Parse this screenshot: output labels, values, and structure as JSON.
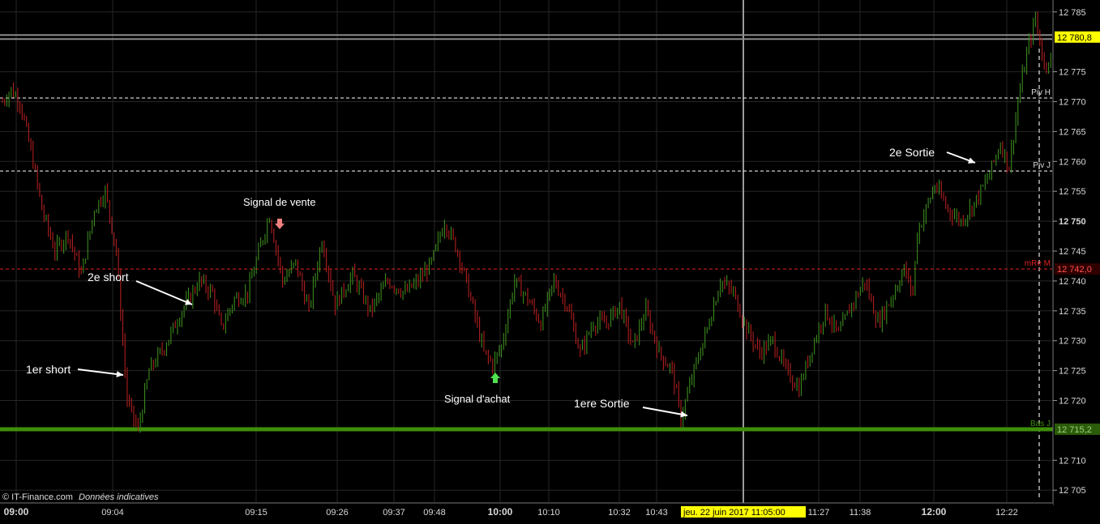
{
  "chart_data": {
    "type": "candlestick",
    "title": "",
    "ylim": [
      12703,
      12787
    ],
    "y_ticks": [
      {
        "value": 12785,
        "label": "12 785"
      },
      {
        "value": 12775,
        "label": "12 775"
      },
      {
        "value": 12770,
        "label": "12 770"
      },
      {
        "value": 12765,
        "label": "12 765"
      },
      {
        "value": 12760,
        "label": "12 760"
      },
      {
        "value": 12755,
        "label": "12 755"
      },
      {
        "value": 12750,
        "label": "12 750",
        "bold": true
      },
      {
        "value": 12745,
        "label": "12 745"
      },
      {
        "value": 12740,
        "label": "12 740"
      },
      {
        "value": 12735,
        "label": "12 735"
      },
      {
        "value": 12730,
        "label": "12 730"
      },
      {
        "value": 12725,
        "label": "12 725"
      },
      {
        "value": 12720,
        "label": "12 720"
      },
      {
        "value": 12710,
        "label": "12 710"
      },
      {
        "value": 12705,
        "label": "12 705"
      }
    ],
    "x_ticks": [
      {
        "time": "09:00",
        "bold": true
      },
      {
        "time": "09:04"
      },
      {
        "time": "09:15"
      },
      {
        "time": "09:26"
      },
      {
        "time": "09:37"
      },
      {
        "time": "09:48"
      },
      {
        "time": "10:00",
        "bold": true
      },
      {
        "time": "10:10"
      },
      {
        "time": "10:32"
      },
      {
        "time": "10:43"
      },
      {
        "time": "11:27"
      },
      {
        "time": "11:38"
      },
      {
        "time": "12:00",
        "bold": true
      },
      {
        "time": "12:22"
      }
    ],
    "crosshair": {
      "label": "jeu. 22 juin 2017 11:05:00"
    },
    "levels": [
      {
        "name": "",
        "value": 12780.8,
        "badge": "12 780,8",
        "style": "current",
        "color": "#8a8a8a",
        "badge_bg": "#ffff00"
      },
      {
        "name": "Piv H",
        "value": 12770.6,
        "style": "dashed",
        "color": "#ffffff"
      },
      {
        "name": "Piv J",
        "value": 12758.4,
        "style": "dashed",
        "color": "#ffffff"
      },
      {
        "name": "mRe M",
        "value": 12742.0,
        "badge": "12 742,0",
        "style": "dashed",
        "color": "#e02020"
      },
      {
        "name": "Bas J",
        "value": 12715.2,
        "badge": "12 715,2",
        "style": "solid",
        "color": "#3e8e0a"
      }
    ],
    "waypoints": [
      [
        0,
        12770
      ],
      [
        4,
        12772
      ],
      [
        8,
        12770
      ],
      [
        14,
        12760
      ],
      [
        18,
        12752
      ],
      [
        24,
        12745
      ],
      [
        30,
        12748
      ],
      [
        36,
        12741
      ],
      [
        42,
        12752
      ],
      [
        47,
        12755
      ],
      [
        52,
        12745
      ],
      [
        57,
        12720
      ],
      [
        62,
        12715
      ],
      [
        67,
        12725
      ],
      [
        74,
        12729
      ],
      [
        82,
        12735
      ],
      [
        90,
        12740
      ],
      [
        96,
        12738
      ],
      [
        100,
        12732
      ],
      [
        106,
        12737
      ],
      [
        112,
        12738
      ],
      [
        118,
        12746
      ],
      [
        122,
        12751
      ],
      [
        128,
        12740
      ],
      [
        134,
        12743
      ],
      [
        140,
        12735
      ],
      [
        146,
        12747
      ],
      [
        152,
        12736
      ],
      [
        160,
        12741
      ],
      [
        168,
        12735
      ],
      [
        176,
        12740
      ],
      [
        184,
        12738
      ],
      [
        190,
        12740
      ],
      [
        196,
        12743
      ],
      [
        202,
        12750
      ],
      [
        208,
        12745
      ],
      [
        214,
        12737
      ],
      [
        220,
        12728
      ],
      [
        224,
        12726
      ],
      [
        228,
        12729
      ],
      [
        234,
        12740
      ],
      [
        240,
        12737
      ],
      [
        246,
        12733
      ],
      [
        252,
        12740
      ],
      [
        258,
        12736
      ],
      [
        264,
        12728
      ],
      [
        270,
        12733
      ],
      [
        276,
        12733
      ],
      [
        282,
        12736
      ],
      [
        288,
        12729
      ],
      [
        294,
        12735
      ],
      [
        300,
        12728
      ],
      [
        306,
        12725
      ],
      [
        310,
        12717
      ],
      [
        316,
        12725
      ],
      [
        322,
        12732
      ],
      [
        328,
        12740
      ],
      [
        334,
        12738
      ],
      [
        340,
        12732
      ],
      [
        346,
        12728
      ],
      [
        352,
        12730
      ],
      [
        358,
        12725
      ],
      [
        364,
        12722
      ],
      [
        370,
        12729
      ],
      [
        376,
        12735
      ],
      [
        382,
        12731
      ],
      [
        388,
        12736
      ],
      [
        394,
        12740
      ],
      [
        400,
        12733
      ],
      [
        406,
        12737
      ],
      [
        412,
        12742
      ],
      [
        416,
        12738
      ],
      [
        418,
        12748
      ],
      [
        426,
        12756
      ],
      [
        432,
        12752
      ],
      [
        438,
        12750
      ],
      [
        444,
        12753
      ],
      [
        450,
        12757
      ],
      [
        456,
        12763
      ],
      [
        460,
        12759
      ],
      [
        464,
        12770
      ],
      [
        468,
        12778
      ],
      [
        472,
        12784
      ],
      [
        476,
        12776
      ],
      [
        480,
        12778
      ],
      [
        484,
        12780
      ]
    ],
    "annotations": [
      {
        "text": "Signal de vente"
      },
      {
        "text": "2e short"
      },
      {
        "text": "1er short"
      },
      {
        "text": "Signal d'achat"
      },
      {
        "text": "1ere Sortie"
      },
      {
        "text": "2e Sortie"
      }
    ],
    "signals": [
      {
        "type": "sell",
        "color": "#f08080"
      },
      {
        "type": "buy",
        "color": "#50e050"
      }
    ]
  },
  "footer": {
    "watermark": "© IT-Finance.com",
    "watermark_note": "Données indicatives"
  },
  "colors": {
    "background": "#000000",
    "up_candle": "#3c8a1e",
    "down_candle": "#b01e1e",
    "grid": "#262626",
    "axis_text": "#d8d8d8"
  }
}
